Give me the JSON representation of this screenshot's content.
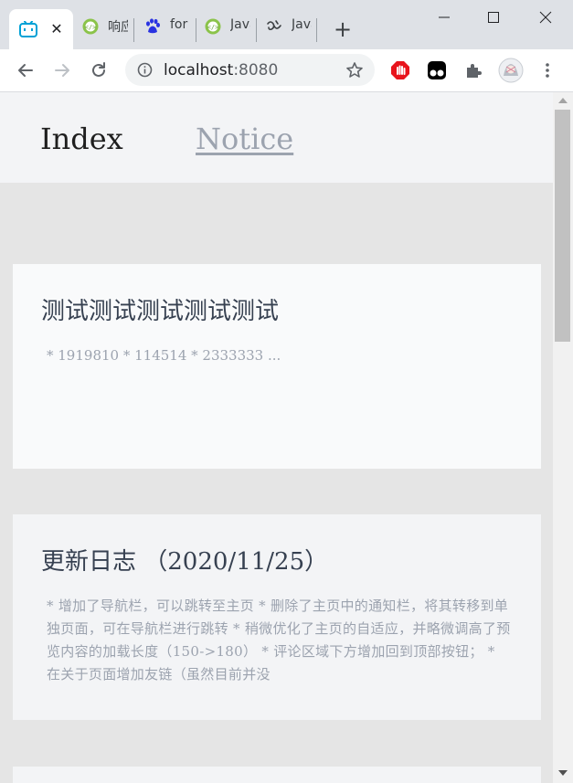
{
  "browser": {
    "tabs": [
      {
        "title": "",
        "icon": "bilibili-icon",
        "active": true
      },
      {
        "title": "响应",
        "icon": "code-icon"
      },
      {
        "title": "for",
        "icon": "baidu-paw-icon"
      },
      {
        "title": "Java",
        "icon": "code-icon"
      },
      {
        "title": "Java",
        "icon": "script-icon"
      }
    ],
    "close_glyph": "✕",
    "new_tab_glyph": "+",
    "url_host": "localhost",
    "url_port": ":8080"
  },
  "site": {
    "nav": {
      "index_label": "Index",
      "notice_label": "Notice"
    },
    "posts": [
      {
        "title": "测试测试测试测试测试",
        "excerpt": "* 1919810 * 114514 * 2333333 ..."
      },
      {
        "title": "更新日志 （2020/11/25）",
        "excerpt": "* 增加了导航栏，可以跳转至主页 * 删除了主页中的通知栏，将其转移到单独页面，可在导航栏进行跳转 * 稍微优化了主页的自适应，并略微调高了预览内容的加载长度（150->180） * 评论区域下方增加回到顶部按钮； * 在关于页面增加友链（虽然目前并没"
      }
    ]
  },
  "colors": {
    "tab_strip": "#dee1e6",
    "page_bg": "#e5e5e5",
    "card_bg": "#f9fafb",
    "nav_text": "#1f1f1f",
    "muted_text": "#9ca3af",
    "extension_red": "#e8141c"
  }
}
